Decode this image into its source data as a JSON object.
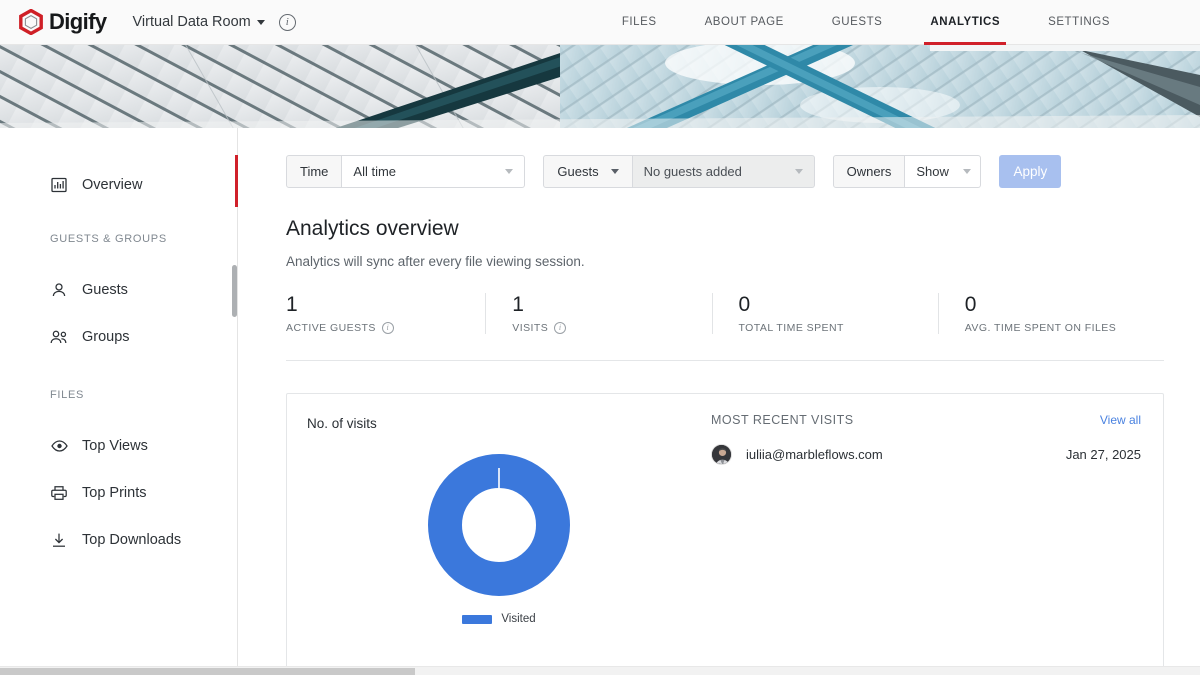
{
  "brand": {
    "name": "Digify",
    "logo_icon": "hexagon-logo-icon"
  },
  "header": {
    "room_name": "Virtual Data Room",
    "room_caret_icon": "chevron-down-icon",
    "info_icon": "info-circle-icon",
    "info_glyph": "i",
    "nav": [
      {
        "label": "FILES",
        "active": false
      },
      {
        "label": "ABOUT PAGE",
        "active": false
      },
      {
        "label": "GUESTS",
        "active": false
      },
      {
        "label": "ANALYTICS",
        "active": true
      },
      {
        "label": "SETTINGS",
        "active": false
      }
    ]
  },
  "sidebar": {
    "items": [
      {
        "label": "Overview",
        "icon": "bar-chart-icon",
        "active": true
      },
      {
        "label": "Guests",
        "icon": "person-icon",
        "active": false
      },
      {
        "label": "Groups",
        "icon": "people-icon",
        "active": false
      },
      {
        "label": "Top Views",
        "icon": "eye-icon",
        "active": false
      },
      {
        "label": "Top Prints",
        "icon": "printer-icon",
        "active": false
      },
      {
        "label": "Top Downloads",
        "icon": "download-icon",
        "active": false
      }
    ],
    "section_guests_groups": "GUESTS & GROUPS",
    "section_files": "FILES"
  },
  "filters": {
    "time": {
      "label": "Time",
      "value": "All time"
    },
    "guests": {
      "label": "Guests",
      "value": "No guests added",
      "disabled": true
    },
    "owners": {
      "label": "Owners",
      "value": "Show"
    },
    "apply_label": "Apply"
  },
  "overview": {
    "title": "Analytics overview",
    "subtitle": "Analytics will sync after every file viewing session.",
    "stats": [
      {
        "value": "1",
        "label": "ACTIVE GUESTS",
        "has_info": true
      },
      {
        "value": "1",
        "label": "VISITS",
        "has_info": true
      },
      {
        "value": "0",
        "label": "TOTAL TIME SPENT",
        "has_info": false
      },
      {
        "value": "0",
        "label": "AVG. TIME SPENT ON FILES",
        "has_info": false
      }
    ]
  },
  "card": {
    "chart_title": "No. of visits",
    "recent_title": "MOST RECENT VISITS",
    "view_all": "View all",
    "visits": [
      {
        "email": "iuliia@marbleflows.com",
        "date": "Jan 27, 2025"
      }
    ]
  },
  "chart_data": {
    "type": "pie",
    "title": "No. of visits",
    "categories": [
      "Visited"
    ],
    "values": [
      1
    ],
    "percentages": [
      100
    ],
    "colors": [
      "#3b78dc"
    ],
    "legend": [
      "Visited"
    ],
    "legend_position": "bottom",
    "donut": true,
    "inner_radius_ratio": 0.55
  },
  "colors": {
    "brand_red": "#d0202a",
    "chart_blue": "#3b78dc",
    "link_blue": "#4a82e0",
    "apply_disabled": "#a8c0ef"
  }
}
